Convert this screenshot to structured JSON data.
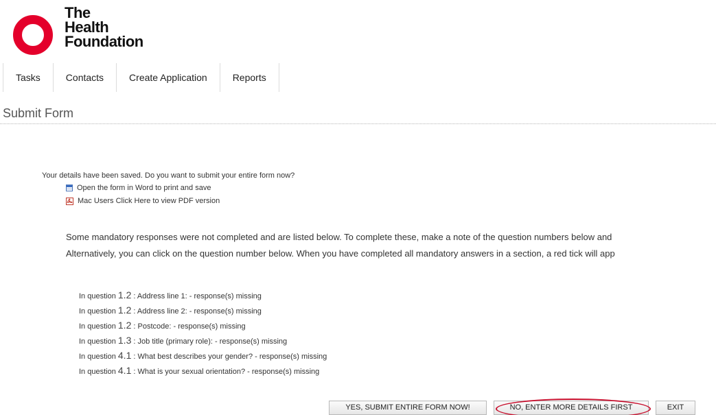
{
  "brand": {
    "logo_lines": [
      "The",
      "Health",
      "Foundation"
    ],
    "accent_color": "#e4002b"
  },
  "nav": {
    "items": [
      {
        "label": "Tasks"
      },
      {
        "label": "Contacts"
      },
      {
        "label": "Create Application"
      },
      {
        "label": "Reports"
      }
    ]
  },
  "page": {
    "title": "Submit Form"
  },
  "saved": {
    "message": "Your details have been saved. Do you want to submit your entire form now?",
    "word_link": "Open the form in Word to print and save",
    "pdf_link": "Mac Users Click Here to view PDF version",
    "word_icon": "word-document-icon",
    "pdf_icon": "pdf-document-icon"
  },
  "mandatory": {
    "line1": "Some mandatory responses were not completed and are listed below. To complete these, make a note of the question numbers below and",
    "line2": "Alternatively, you can click on the question number below. When you have completed all mandatory answers in a section, a red tick will app"
  },
  "missing": {
    "prefix": "In question",
    "items": [
      {
        "number": "1.2",
        "text": ": Address line 1: - response(s) missing"
      },
      {
        "number": "1.2",
        "text": ": Address line 2: - response(s) missing"
      },
      {
        "number": "1.2",
        "text": ": Postcode: - response(s) missing"
      },
      {
        "number": "1.3",
        "text": ": Job title (primary role): - response(s) missing"
      },
      {
        "number": "4.1",
        "text": ": What best describes your gender? - response(s) missing"
      },
      {
        "number": "4.1",
        "text": ": What is your sexual orientation? - response(s) missing"
      }
    ]
  },
  "actions": {
    "submit_label": "YES, SUBMIT ENTIRE FORM NOW!",
    "more_details_label": "NO, ENTER MORE DETAILS FIRST",
    "exit_label": "EXIT",
    "highlight_color": "#c8102e"
  }
}
